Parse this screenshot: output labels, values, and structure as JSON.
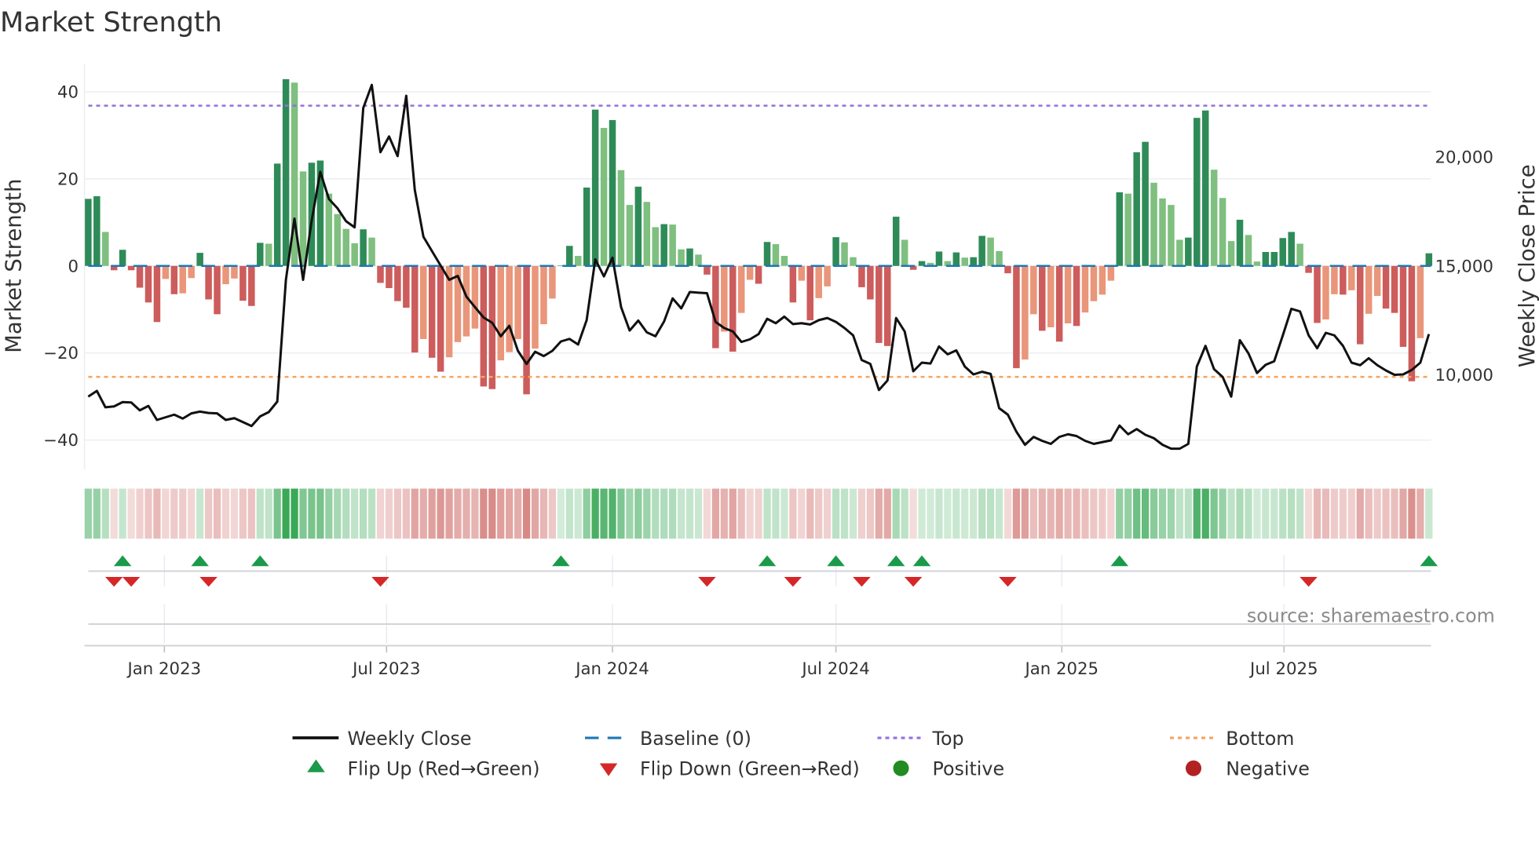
{
  "chart_data": {
    "type": "bar",
    "title": "Market Strength",
    "ylabel": "Market Strength",
    "y2label": "Weekly Close Price",
    "ylim": [
      -46,
      48
    ],
    "yticks": [
      40,
      20,
      0,
      -20,
      -40
    ],
    "ytick_labels": [
      "40",
      "20",
      "0",
      "−20",
      "−40"
    ],
    "y2ticks": [
      20000,
      15000,
      10000
    ],
    "y2tick_labels": [
      "20,000",
      "15,000",
      "10,000"
    ],
    "xticks": [
      "2023-01-01",
      "2023-07-01",
      "2024-01-01",
      "2024-07-01",
      "2025-01-01",
      "2025-07-01"
    ],
    "xtick_labels": [
      "Jan 2023",
      "Jul 2023",
      "Jan 2024",
      "Jul 2024",
      "Jan 2025",
      "Jul 2025"
    ],
    "start_date": "2022-10-31",
    "interval": "weekly",
    "top_level": 36.8,
    "bottom_level": -25.5,
    "baseline": 0,
    "grid": true,
    "legend_position": "bottom",
    "strength": [
      15.4,
      16,
      7.8,
      -1,
      3.7,
      -1,
      -5,
      -8.4,
      -12.9,
      -3,
      -6.5,
      -6.3,
      -2.8,
      3,
      -7.7,
      -11.1,
      -4.2,
      -2.9,
      -8,
      -9.2,
      5.3,
      5.1,
      23.5,
      42.9,
      42.1,
      21.7,
      23.7,
      24.2,
      16.6,
      11.9,
      8.5,
      5.2,
      8.4,
      6.5,
      -3.9,
      -5.1,
      -8.1,
      -9.6,
      -19.9,
      -16.8,
      -21.1,
      -24.3,
      -21,
      -17.5,
      -16.2,
      -14.4,
      -27.7,
      -28.3,
      -21.7,
      -19.8,
      -16.8,
      -29.5,
      -19,
      -13.4,
      -7.5,
      0.1,
      4.6,
      2.3,
      18,
      35.9,
      31.7,
      33.5,
      22,
      14,
      18.2,
      14.7,
      8.9,
      9.6,
      9.5,
      3.8,
      4,
      2.6,
      -2,
      -18.9,
      -15.1,
      -19.7,
      -10.8,
      -3.2,
      -4.1,
      5.5,
      5,
      2.3,
      -8.4,
      -3.4,
      -12.5,
      -7.4,
      -4.7,
      6.6,
      5.4,
      2,
      -4.9,
      -7.7,
      -17.7,
      -18.4,
      11.3,
      6,
      -0.9,
      1.1,
      0.7,
      3.3,
      1.1,
      3.1,
      1.9,
      2,
      6.9,
      6.5,
      3.4,
      -1.7,
      -23.5,
      -21.5,
      -11.1,
      -14.9,
      -14.1,
      -17.4,
      -13.2,
      -13.8,
      -10.7,
      -8.1,
      -6.6,
      -3.4,
      16.9,
      16.6,
      26.1,
      28.5,
      19.1,
      15.5,
      14,
      6,
      6.5,
      34,
      35.7,
      22.1,
      15.6,
      5.7,
      10.6,
      7.1,
      1,
      3.2,
      3.2,
      6.4,
      7.8,
      5.1,
      -1.6,
      -13.1,
      -12.3,
      -6.5,
      -6.6,
      -5.6,
      -18,
      -11,
      -6.9,
      -9.8,
      -10.8,
      -18.6,
      -26.5,
      -16.6,
      2.9
    ],
    "weekly_close": [
      9000,
      9260,
      8510,
      8550,
      8750,
      8730,
      8370,
      8570,
      7930,
      8050,
      8170,
      7990,
      8230,
      8310,
      8250,
      8230,
      7930,
      8010,
      7830,
      7650,
      8090,
      8290,
      8770,
      14360,
      17170,
      14360,
      17090,
      19320,
      18070,
      17650,
      17050,
      16770,
      22250,
      23310,
      20220,
      20940,
      20040,
      22810,
      18490,
      16340,
      15680,
      15020,
      14360,
      14540,
      13590,
      13110,
      12630,
      12390,
      11770,
      12250,
      11100,
      10500,
      11060,
      10860,
      11100,
      11530,
      11650,
      11390,
      12510,
      15300,
      14520,
      15380,
      13110,
      12030,
      12490,
      11950,
      11770,
      12450,
      13510,
      13050,
      13800,
      13770,
      13750,
      12430,
      12150,
      11990,
      11510,
      11630,
      11870,
      12570,
      12370,
      12670,
      12330,
      12370,
      12310,
      12510,
      12610,
      12430,
      12150,
      11810,
      10680,
      10500,
      9300,
      9740,
      12610,
      11990,
      10160,
      10560,
      10520,
      11300,
      10940,
      11120,
      10380,
      10020,
      10140,
      10040,
      8470,
      8170,
      7390,
      6790,
      7150,
      6970,
      6830,
      7150,
      7270,
      7190,
      6970,
      6830,
      6910,
      6990,
      7670,
      7270,
      7510,
      7250,
      7090,
      6790,
      6610,
      6610,
      6830,
      10380,
      11330,
      10260,
      9900,
      9000,
      11590,
      10980,
      10080,
      10460,
      10620,
      11810,
      13030,
      12910,
      11810,
      11220,
      11930,
      11810,
      11330,
      10560,
      10440,
      10760,
      10440,
      10200,
      10000,
      10020,
      10220,
      10560,
      11870
    ]
  },
  "legend": {
    "weekly_close": "Weekly Close",
    "baseline": "Baseline (0)",
    "top": "Top",
    "bottom": "Bottom",
    "flip_up": "Flip Up (Red→Green)",
    "flip_down": "Flip Down (Green→Red)",
    "positive": "Positive",
    "negative": "Negative"
  },
  "source": "source: sharemaestro.com",
  "colors": {
    "pos_strong": "#2e8b57",
    "pos_weak": "#7fbf7f",
    "neg_strong": "#cd5c5c",
    "neg_weak": "#e9967a",
    "baseline": "#1f77b4",
    "top": "#9370db",
    "bottom": "#f4a460",
    "flip_up": "#1a9a4a",
    "flip_down": "#d62728",
    "positive": "#228b22",
    "negative": "#b22222",
    "heat_pos": "#3aa857",
    "heat_neg": "#cd6a66"
  }
}
